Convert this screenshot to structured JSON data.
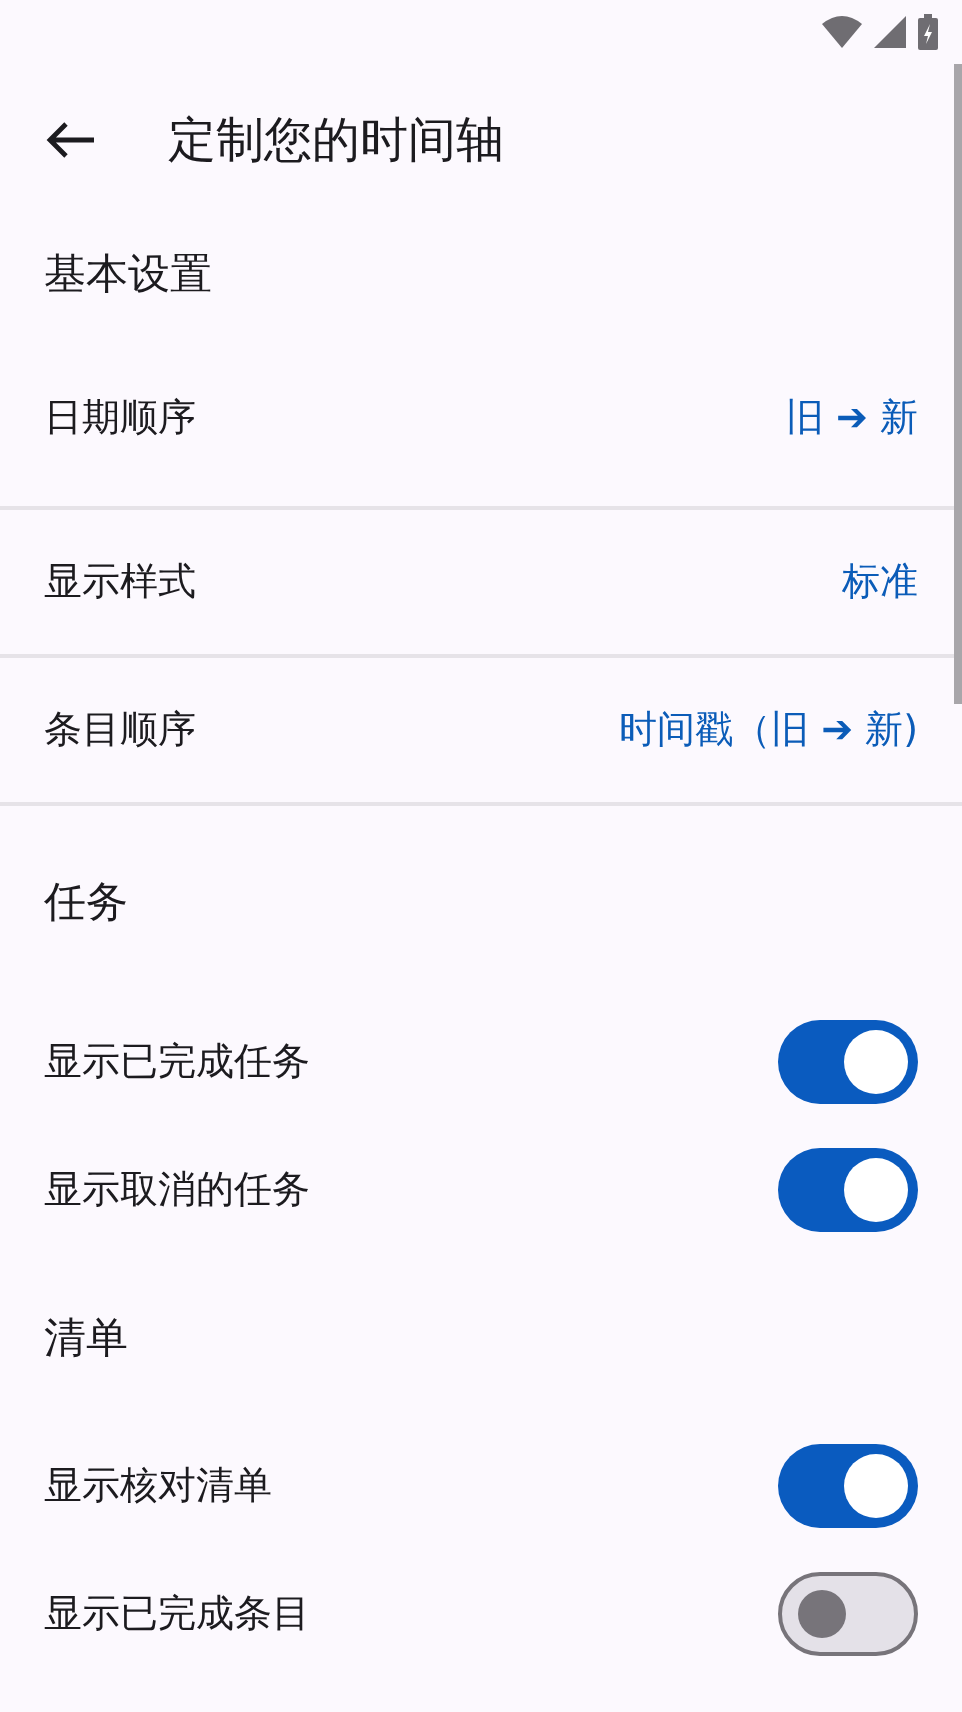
{
  "app_bar": {
    "title": "定制您的时间轴"
  },
  "sections": [
    {
      "heading": "基本设置",
      "rows": [
        {
          "kind": "value",
          "label": "日期顺序",
          "value": "旧 ➔ 新"
        },
        {
          "kind": "value",
          "label": "显示样式",
          "value": "标准"
        },
        {
          "kind": "value",
          "label": "条目顺序",
          "value": "时间戳（旧 ➔ 新)"
        }
      ]
    },
    {
      "heading": "任务",
      "rows": [
        {
          "kind": "switch",
          "label": "显示已完成任务",
          "on": true
        },
        {
          "kind": "switch",
          "label": "显示取消的任务",
          "on": true
        }
      ]
    },
    {
      "heading": "清单",
      "rows": [
        {
          "kind": "switch",
          "label": "显示核对清单",
          "on": true
        },
        {
          "kind": "switch",
          "label": "显示已完成条目",
          "on": false
        }
      ]
    }
  ]
}
